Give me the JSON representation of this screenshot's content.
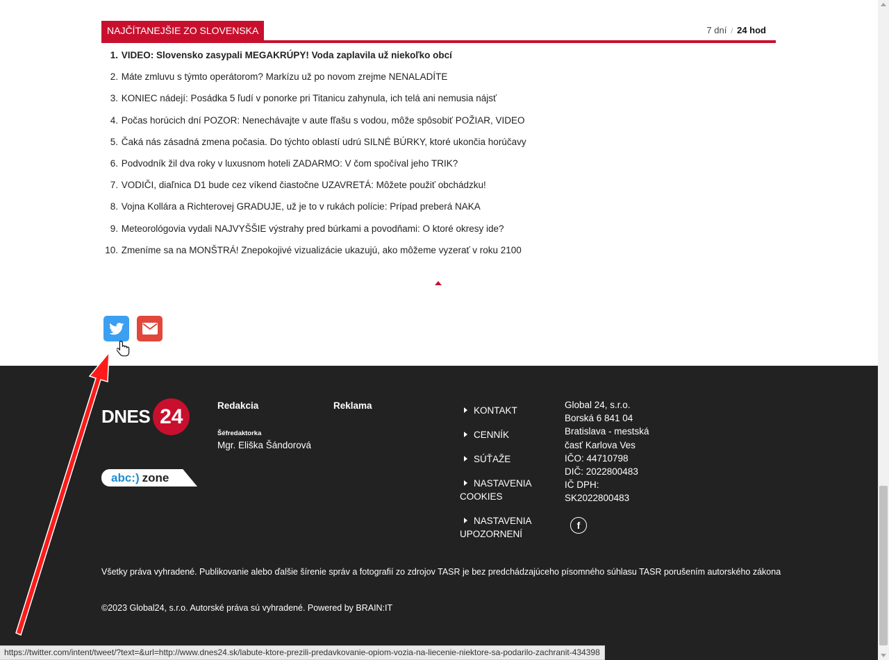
{
  "most_read": {
    "title": "NAJČÍTANEJŠIE ZO SLOVENSKA",
    "tabs": [
      "7 dní",
      "24 hod"
    ],
    "tab_separator": "/",
    "items": [
      {
        "num": "1.",
        "text": "VIDEO: Slovensko zasypali MEGAKRÚPY! Voda zaplavila už niekoľko obcí"
      },
      {
        "num": "2.",
        "text": "Máte zmluvu s týmto operátorom? Markízu už po novom zrejme NENALADÍTE"
      },
      {
        "num": "3.",
        "text": "KONIEC nádejí: Posádka 5 ľudí v ponorke pri Titanicu zahynula, ich telá ani nemusia nájsť"
      },
      {
        "num": "4.",
        "text": "Počas horúcich dní POZOR: Nenechávajte v aute fľašu s vodou, môže spôsobiť POŽIAR, VIDEO"
      },
      {
        "num": "5.",
        "text": "Čaká nás zásadná zmena počasia. Do týchto oblastí udrú SILNÉ BÚRKY, ktoré ukončia horúčavy"
      },
      {
        "num": "6.",
        "text": "Podvodník žil dva roky v luxusnom hoteli ZADARMO: V čom spočíval jeho TRIK?"
      },
      {
        "num": "7.",
        "text": "VODIČI, diaľnica D1 bude cez víkend čiastočne UZAVRETÁ: Môžete použiť obchádzku!"
      },
      {
        "num": "8.",
        "text": "Vojna Kollára a Richterovej GRADUJE, už je to v rukách polície: Prípad preberá NAKA"
      },
      {
        "num": "9.",
        "text": "Meteorológovia vydali NAJVYŠŠIE výstrahy pred búrkami a povodňami: O ktoré okresy ide?"
      },
      {
        "num": "10.",
        "text": "Zmeníme sa na MONŠTRÁ! Znepokojivé vizualizácie ukazujú, ako môžeme vyzerať v roku 2100"
      }
    ]
  },
  "share": {
    "twitter_icon": "twitter-icon",
    "mail_icon": "envelope-icon"
  },
  "footer": {
    "logo_text": "DNES",
    "logo_number": "24",
    "abc_zone_part1": "abc:)",
    "abc_zone_part2": "zone",
    "col_redakcia": "Redakcia",
    "col_reklama": "Reklama",
    "editor_role": "Šéfredaktorka",
    "editor_name": "Mgr. Eliška Šándorová",
    "links": [
      "KONTAKT",
      "CENNÍK",
      "SÚŤAŽE",
      "NASTAVENIA COOKIES",
      "NASTAVENIA UPOZORNENÍ"
    ],
    "address": [
      "Global 24, s.r.o.",
      "Borská 6 841 04",
      "Bratislava - mestská časť Karlova Ves",
      "IČO: 44710798",
      "DIČ: 2022800483",
      "IČ DPH: SK2022800483"
    ],
    "social_icon": "facebook-icon",
    "rights": "Všetky práva vyhradené. Publikovanie alebo ďalšie šírenie správ a fotografií zo zdrojov TASR je bez predchádzajúceho písomného súhlasu TASR porušením autorského zákona",
    "copyright": "©2023 Global24, s.r.o. Autorské práva sú vyhradené. Powered by BRAIN:IT"
  },
  "status_bar": {
    "url": "https://twitter.com/intent/tweet/?text=&url=http://www.dnes24.sk/labute-ktore-prezili-predavkovanie-opiom-vozia-na-liecenie-niektore-sa-podarilo-zachranit-434398"
  },
  "colors": {
    "accent": "#c8102e",
    "twitter": "#3b9ff2",
    "mail": "#e1473b",
    "footer_bg": "#222222"
  }
}
